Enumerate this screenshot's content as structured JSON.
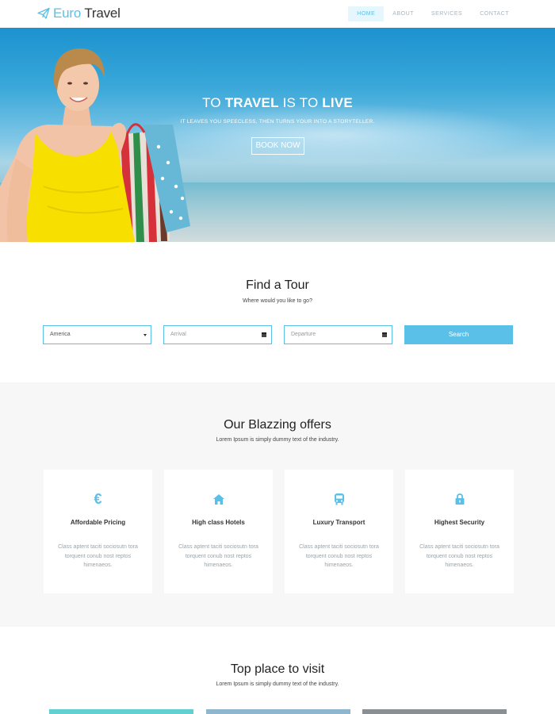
{
  "nav": {
    "logo_first": "Euro",
    "logo_second": "Travel",
    "menu": [
      "HOME",
      "ABOUT",
      "SERVICES",
      "CONTACT"
    ],
    "active_index": 0
  },
  "hero": {
    "title_pre": "TO ",
    "title_bold1": "TRAVEL",
    "title_mid": " IS TO ",
    "title_bold2": "LIVE",
    "subtitle": "IT LEAVES YOU SPEECLESS, THEN TURNS YOUR INTO A STORYTELLER.",
    "button": "BOOK NOW"
  },
  "find_tour": {
    "title": "Find a Tour",
    "subtitle": "Where would you like to go?",
    "destination_value": "America",
    "arrival_placeholder": "Arrival",
    "departure_placeholder": "Departure",
    "search_label": "Search"
  },
  "offers": {
    "title": "Our Blazzing offers",
    "subtitle": "Lorem Ipsum is simply dummy text of the industry.",
    "cards": [
      {
        "icon": "euro-icon",
        "title": "Affordable Pricing",
        "text": "Class aptent taciti sociosutn tora torquent conub nost reptos himenaeos."
      },
      {
        "icon": "home-icon",
        "title": "High class Hotels",
        "text": "Class aptent taciti sociosutn tora torquent conub nost reptos himenaeos."
      },
      {
        "icon": "bus-icon",
        "title": "Luxury Transport",
        "text": "Class aptent taciti sociosutn tora torquent conub nost reptos himenaeos."
      },
      {
        "icon": "lock-icon",
        "title": "Highest Security",
        "text": "Class aptent taciti sociosutn tora torquent conub nost reptos himenaeos."
      }
    ]
  },
  "places": {
    "title": "Top place to visit",
    "subtitle": "Lorem Ipsum is simply dummy text of the industry."
  },
  "colors": {
    "accent": "#5bc0e8",
    "text_dark": "#222222",
    "offers_bg": "#f7f7f7"
  }
}
